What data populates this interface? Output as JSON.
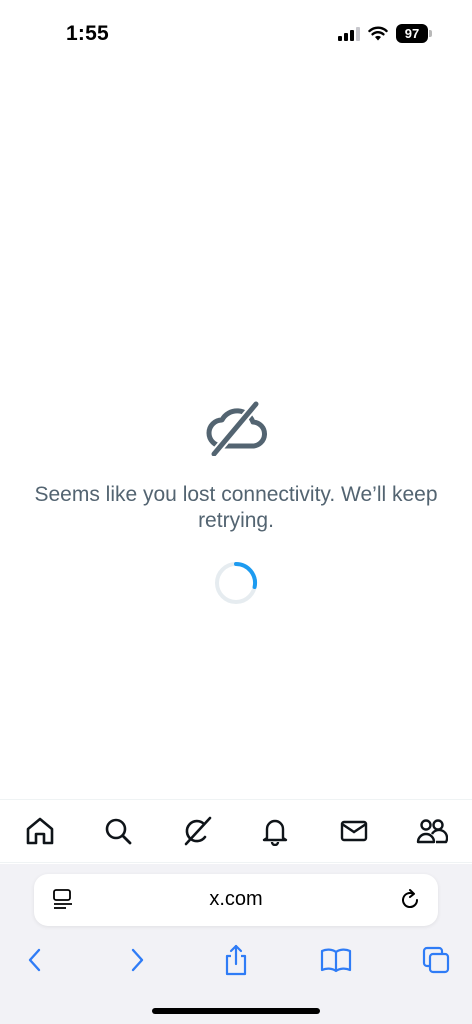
{
  "status_bar": {
    "time": "1:55",
    "battery": "97"
  },
  "offline": {
    "icon": "cloud-off-icon",
    "message": "Seems like you lost connectivity. We’ll keep retrying."
  },
  "tab_bar": {
    "tabs": [
      {
        "icon": "home-icon"
      },
      {
        "icon": "search-icon"
      },
      {
        "icon": "grok-icon"
      },
      {
        "icon": "bell-icon"
      },
      {
        "icon": "mail-icon"
      },
      {
        "icon": "communities-icon"
      }
    ]
  },
  "browser": {
    "url": "x.com",
    "toolbar": [
      "back-icon",
      "forward-icon",
      "share-icon",
      "bookmarks-icon",
      "tabs-icon"
    ]
  },
  "colors": {
    "accent": "#1d9bf0",
    "safari_accent": "#2f7cf6",
    "message_text": "#536471"
  }
}
